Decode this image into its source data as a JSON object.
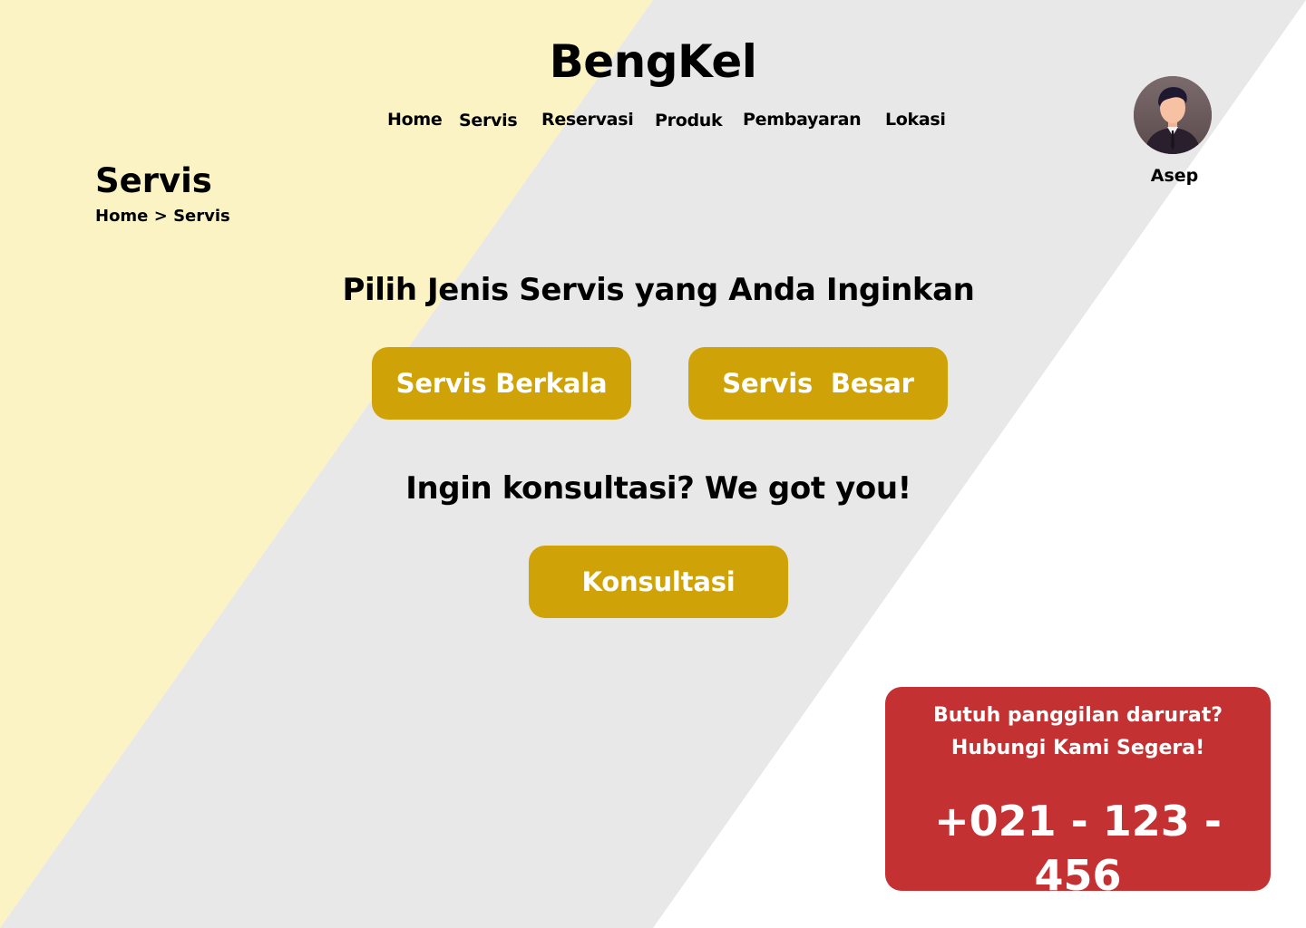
{
  "brand": {
    "name": "BengKel"
  },
  "nav": {
    "items": [
      {
        "label": "Home"
      },
      {
        "label": "Servis"
      },
      {
        "label": "Reservasi"
      },
      {
        "label": "Produk"
      },
      {
        "label": "Pembayaran"
      },
      {
        "label": "Lokasi"
      }
    ]
  },
  "user": {
    "name": "Asep"
  },
  "page": {
    "title": "Servis",
    "breadcrumb": {
      "home": "Home",
      "separator": ">",
      "current": "Servis"
    }
  },
  "service_section": {
    "heading": "Pilih Jenis Servis yang Anda Inginkan",
    "buttons": [
      {
        "label": "Servis Berkala"
      },
      {
        "label": "Servis  Besar"
      }
    ]
  },
  "consult_section": {
    "heading": "Ingin konsultasi? We got you!",
    "button_label": "Konsultasi"
  },
  "emergency": {
    "line1": "Butuh panggilan darurat?",
    "line2": "Hubungi Kami Segera!",
    "phone": "+021 - 123 - 456"
  },
  "colors": {
    "background_yellow": "#fbf3c4",
    "background_gray": "#e8e8e8",
    "button_gold": "#cfa308",
    "emergency_red": "#c33132",
    "text": "#000000",
    "button_text": "#ffffff"
  }
}
